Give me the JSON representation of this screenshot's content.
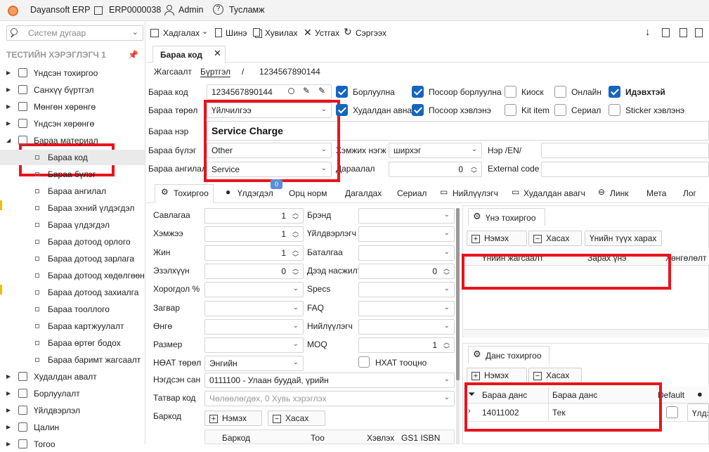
{
  "topbar": {
    "app": "Dayansoft ERP",
    "company": "ERP0000038",
    "user": "Admin",
    "help": "Тусламж"
  },
  "sidebar": {
    "search_placeholder": "Систем дугаар",
    "group_title": "ТЕСТИЙН ХЭРЭГЛЭГЧ 1",
    "top_items": [
      "Үндсэн тохиргоо",
      "Санхүү бүртгэл",
      "Мөнгөн хөрөнгө",
      "Үндсэн хөрөнгө",
      "Бараа материал"
    ],
    "sub_items": [
      "Бараа код",
      "Бараа бүлэг",
      "Бараа ангилал",
      "Бараа эхний үлдэгдэл",
      "Бараа үлдэгдэл",
      "Бараа дотоод орлого",
      "Бараа дотоод зарлага",
      "Бараа дотоод хөдөлгөөн",
      "Бараа дотоод захиалга",
      "Бараа тооллого",
      "Бараа картжуулалт",
      "Бараа өртөг бодох",
      "Бараа баримт жагсаалт"
    ],
    "bottom_items": [
      "Худалдан авалт",
      "Борлуулалт",
      "Үйлдвэрлэл",
      "Цалин",
      "Тогоо"
    ]
  },
  "toolbar": {
    "save": "Хадгалах",
    "new": "Шинэ",
    "copy": "Хувилах",
    "delete": "Устгах",
    "refresh": "Сэргээх"
  },
  "doc_tab": "Бараа код",
  "breadcrumb": {
    "list": "Жагсаалт",
    "register": "Бүртгэл",
    "sep": "/",
    "code": "1234567890144"
  },
  "form": {
    "code_label": "Бараа код",
    "code_value": "1234567890144",
    "type_label": "Бараа төрөл",
    "type_value": "Үйлчилгээ",
    "name_label": "Бараа нэр",
    "name_value": "Service Charge",
    "group_label": "Бараа бүлэг",
    "group_value": "Other",
    "class_label": "Бараа ангилал",
    "class_value": "Service",
    "unit_label": "Хэмжих нэгж",
    "unit_value": "ширхэг",
    "order_label": "Дараалал",
    "order_value": "0",
    "name_en_label": "Нэр /EN/",
    "external_label": "External code"
  },
  "checkboxes": [
    {
      "label": "Борлуулна",
      "checked": true
    },
    {
      "label": "Посоор борлуулна",
      "checked": true
    },
    {
      "label": "Киоск",
      "checked": false
    },
    {
      "label": "Онлайн",
      "checked": false
    },
    {
      "label": "Идэвхтэй",
      "checked": true
    },
    {
      "label": "Худалдан авна",
      "checked": true
    },
    {
      "label": "Посоор хэвлэнэ",
      "checked": true
    },
    {
      "label": "Kit item",
      "checked": false
    },
    {
      "label": "Сериал",
      "checked": false
    },
    {
      "label": "Sticker хэвлэнэ",
      "checked": false
    }
  ],
  "tabs": [
    "Тохиргоо",
    "Үлдэгдэл",
    "Орц норм",
    "Дагалдах",
    "Сериал",
    "Нийлүүлэгч",
    "Худалдан авагч",
    "Линк",
    "Мета",
    "Лог"
  ],
  "tab_badge": "0",
  "settings_left": [
    {
      "label": "Савлагаа",
      "value": "1"
    },
    {
      "label": "Хэмжээ",
      "value": "1"
    },
    {
      "label": "Жин",
      "value": "1"
    },
    {
      "label": "Эзэлхүүн",
      "value": "0"
    },
    {
      "label": "Хорогдол %",
      "value": ""
    },
    {
      "label": "Загвар",
      "value": ""
    },
    {
      "label": "Өнгө",
      "value": ""
    },
    {
      "label": "Размер",
      "value": ""
    },
    {
      "label": "НӨАТ төрөл",
      "value": "Энгийн"
    }
  ],
  "settings_right": [
    {
      "label": "Брэнд",
      "value": ""
    },
    {
      "label": "Үйлдвэрлэгч",
      "value": ""
    },
    {
      "label": "Баталгаа",
      "value": ""
    },
    {
      "label": "Дээд насжилт",
      "value": "0"
    },
    {
      "label": "Specs",
      "value": ""
    },
    {
      "label": "FAQ",
      "value": ""
    },
    {
      "label": "Нийлүүлэгч",
      "value": ""
    },
    {
      "label": "MOQ",
      "value": "1"
    }
  ],
  "nhat_label": "НХАТ тооцно",
  "tax_label": "Нэгдсэн сан",
  "tax_value": "0111100 - Улаан буудай, үрийн",
  "tatvar_label": "Татвар код",
  "tatvar_placeholder": "Чөлөөлөгдөх, 0 Хувь хэрэглэх",
  "barcode_label": "Баркод",
  "add": "Нэмэх",
  "remove": "Хасах",
  "barcode_cols": [
    "Баркод",
    "Тоо",
    "Хэвлэх",
    "GS1 ISBN"
  ],
  "price_panel": {
    "title": "Үнэ тохиргоо",
    "history": "Үнийн түүх харах",
    "cols": [
      "Үнийн жагсаалт",
      "Зарах үнэ",
      "Хөнгөлөлт %"
    ]
  },
  "account_panel": {
    "title": "Данс тохиргоо",
    "cols": [
      "Бараа данс",
      "Бараа данс",
      "Default"
    ],
    "row": {
      "code": "14011002",
      "name": "Тек"
    },
    "extra": "Үлдэ"
  }
}
